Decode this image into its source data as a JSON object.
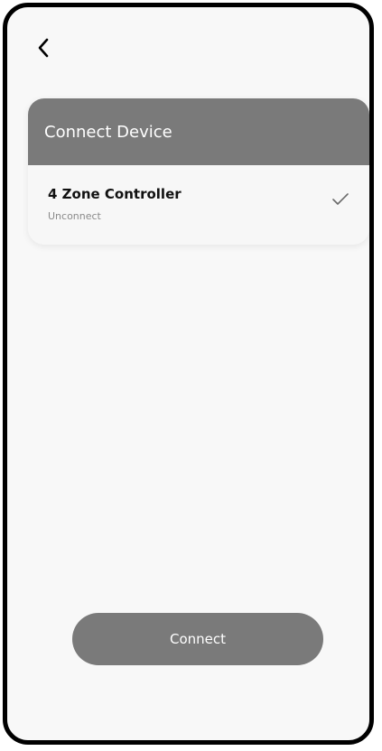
{
  "header": {
    "back_icon": "chevron-left-icon"
  },
  "card": {
    "title": "Connect Device",
    "devices": [
      {
        "name": "4 Zone Controller",
        "status": "Unconnect",
        "selected": true,
        "check_icon": "checkmark-icon"
      }
    ]
  },
  "footer": {
    "connect_label": "Connect"
  },
  "colors": {
    "header_bg": "#7a7a7a",
    "button_bg": "#7a7a7a",
    "frame": "#000000",
    "screen_bg": "#f8f8f8"
  }
}
